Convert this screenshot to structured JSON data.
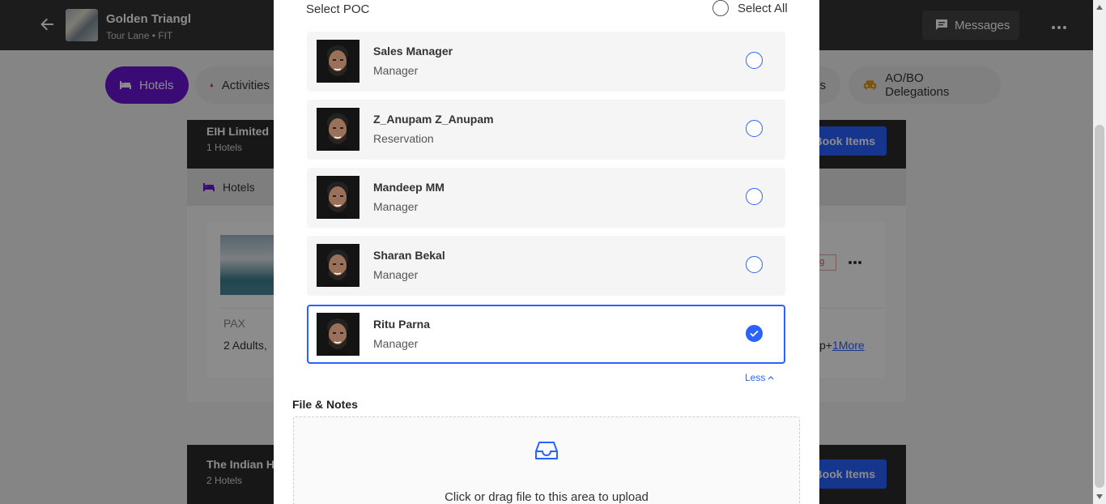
{
  "header": {
    "trip_title": "Golden Triangl",
    "trip_sub": "Tour Lane • FIT",
    "messages_label": "Messages"
  },
  "tabs": [
    {
      "label": "Hotels",
      "active": true
    },
    {
      "label": "Activities",
      "active": false
    },
    {
      "label": "es",
      "active": false
    },
    {
      "label": "AO/BO Delegations",
      "active": false
    }
  ],
  "cards": [
    {
      "title": "EIH Limited",
      "sub": "1 Hotels",
      "book_label": "Book Items"
    },
    {
      "title": "The Indian H",
      "sub": "2 Hotels",
      "book_label": "Book Items"
    }
  ],
  "hotels_section": {
    "label": "Hotels",
    "pax_label": "PAX",
    "pax_value": "2 Adults,",
    "status_tag": "ng",
    "more_prefix": "p+",
    "more_link": "1More"
  },
  "modal": {
    "heading": "Select POC",
    "select_all": "Select All",
    "pocs": [
      {
        "name": "Sales Manager",
        "role": "Manager",
        "selected": false
      },
      {
        "name": "Z_Anupam Z_Anupam",
        "role": "Reservation",
        "selected": false
      },
      {
        "name": "Mandeep MM",
        "role": "Manager",
        "selected": false
      },
      {
        "name": "Sharan Bekal",
        "role": "Manager",
        "selected": false
      },
      {
        "name": "Ritu Parna",
        "role": "Manager",
        "selected": true
      }
    ],
    "less_label": "Less",
    "files_title": "File & Notes",
    "upload_text": "Click or drag file to this area to upload"
  },
  "colors": {
    "accent": "#2962ff",
    "tab_active": "#6c14d6",
    "topbar": "#333333"
  }
}
